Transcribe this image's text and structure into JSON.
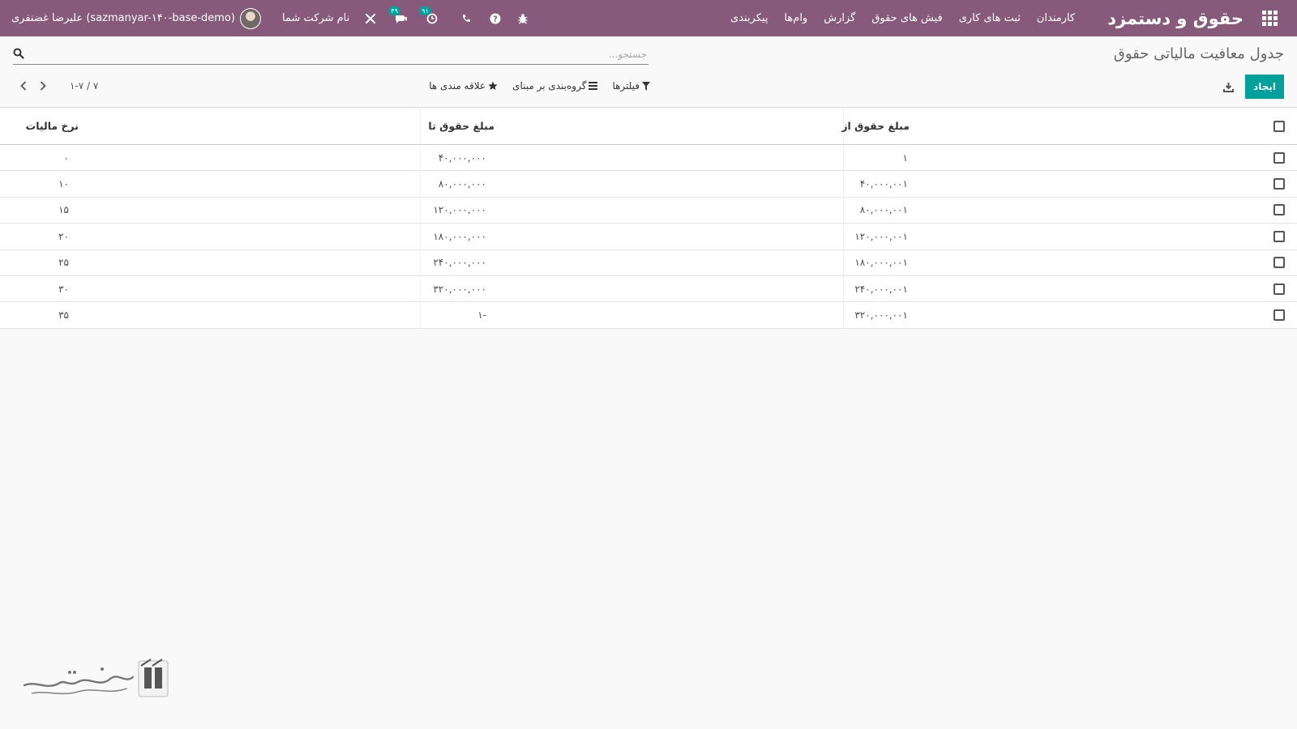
{
  "navbar": {
    "brand": "حقوق و دستمزد",
    "menu": [
      "کارمندان",
      "ثبت های کاری",
      "فیش های حقوق",
      "گزارش",
      "وام‌ها",
      "پیکربندی"
    ],
    "user_name": "علیرضا غضنفری (sazmanyar-۱۴۰-base-demo)",
    "company": "نام شرکت شما",
    "activity_badge": "۹۱",
    "messages_badge": "۴۹"
  },
  "control": {
    "title": "جدول معافیت مالیاتی حقوق",
    "search_placeholder": "جستجو...",
    "create_label": "ایجاد",
    "filters_label": "فیلترها",
    "groupby_label": "گروه‌بندی بر مبنای",
    "favorites_label": "علاقه مندی ها",
    "pager": "۱-۷ / ۷"
  },
  "table": {
    "columns": [
      "مبلغ حقوق از",
      "مبلغ حقوق تا",
      "نرخ مالیات"
    ],
    "rows": [
      {
        "from": "۱",
        "to": "۴۰,۰۰۰,۰۰۰",
        "rate": "۰"
      },
      {
        "from": "۴۰,۰۰۰,۰۰۱",
        "to": "۸۰,۰۰۰,۰۰۰",
        "rate": "۱۰"
      },
      {
        "from": "۸۰,۰۰۰,۰۰۱",
        "to": "۱۲۰,۰۰۰,۰۰۰",
        "rate": "۱۵"
      },
      {
        "from": "۱۲۰,۰۰۰,۰۰۱",
        "to": "۱۸۰,۰۰۰,۰۰۰",
        "rate": "۲۰"
      },
      {
        "from": "۱۸۰,۰۰۰,۰۰۱",
        "to": "۲۴۰,۰۰۰,۰۰۰",
        "rate": "۲۵"
      },
      {
        "from": "۲۴۰,۰۰۰,۰۰۱",
        "to": "۳۲۰,۰۰۰,۰۰۰",
        "rate": "۳۰"
      },
      {
        "from": "۳۲۰,۰۰۰,۰۰۱",
        "to": "۱-",
        "rate": "۳۵"
      }
    ]
  },
  "colors": {
    "navbar": "#875a7b",
    "primary": "#00a09d"
  },
  "watermark": "تسهیل‌گستر"
}
